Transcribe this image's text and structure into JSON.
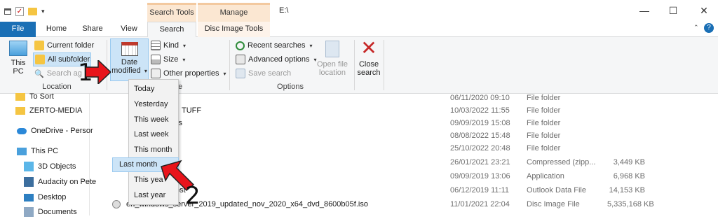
{
  "title": {
    "path": "E:\\"
  },
  "context_tabs": {
    "search_tools": "Search Tools",
    "manage": "Manage"
  },
  "tabs": [
    {
      "label": "File"
    },
    {
      "label": "Home"
    },
    {
      "label": "Share"
    },
    {
      "label": "View"
    },
    {
      "label": "Search"
    },
    {
      "label": "Disc Image Tools"
    }
  ],
  "ribbon": {
    "location": {
      "this_pc": "This PC",
      "current_folder": "Current folder",
      "all_subfolders": "All subfolders",
      "search_again": "Search again in",
      "label": "Location"
    },
    "refine": {
      "date_modified_line1": "Date",
      "date_modified_line2": "modified",
      "kind": "Kind",
      "size": "Size",
      "other_properties": "Other properties",
      "label": "e"
    },
    "options": {
      "recent_searches": "Recent searches",
      "advanced_options": "Advanced options",
      "save_search": "Save search",
      "open_file_location_1": "Open file",
      "open_file_location_2": "location",
      "label": "Options"
    },
    "close": {
      "line1": "Close",
      "line2": "search"
    }
  },
  "date_menu": [
    "Today",
    "Yesterday",
    "This week",
    "Last week",
    "This month",
    "Last month",
    "This year",
    "Last year"
  ],
  "date_menu_visible": [
    "Today",
    "Yesterday",
    "This week",
    "Last week",
    "This month",
    "Last month",
    "This yea",
    "Last year"
  ],
  "nav": [
    {
      "label": "To Sort",
      "icon": "folder-icon"
    },
    {
      "label": "ZERTO-MEDIA",
      "icon": "folder-icon"
    },
    {
      "label": "OneDrive - Persor",
      "icon": "cloud-icon"
    },
    {
      "label": "This PC",
      "icon": "computer-icon"
    },
    {
      "label": "3D Objects",
      "icon": "cube-icon"
    },
    {
      "label": "Audacity on Pete",
      "icon": "audio-icon"
    },
    {
      "label": "Desktop",
      "icon": "desktop-icon"
    },
    {
      "label": "Documents",
      "icon": "documents-icon"
    }
  ],
  "files": [
    {
      "name": "",
      "date": "06/11/2020 09:10",
      "type": "File folder",
      "size": ""
    },
    {
      "name": "TUFF",
      "date": "10/03/2022 11:55",
      "type": "File folder",
      "size": ""
    },
    {
      "name": "ls",
      "date": "09/09/2019 15:08",
      "type": "File folder",
      "size": ""
    },
    {
      "name": "",
      "date": "08/08/2022 15:48",
      "type": "File folder",
      "size": ""
    },
    {
      "name": "",
      "date": "25/10/2022 20:48",
      "type": "File folder",
      "size": ""
    },
    {
      "name": "",
      "date": "26/01/2021 23:21",
      "type": "Compressed (zipp...",
      "size": "3,449 KB"
    },
    {
      "name": "",
      "date": "09/09/2019 13:06",
      "type": "Application",
      "size": "6,968 KB"
    },
    {
      "name": "pst",
      "date": "06/12/2019 11:11",
      "type": "Outlook Data File",
      "size": "14,153 KB"
    },
    {
      "name": "en_windows_server_2019_updated_nov_2020_x64_dvd_8600b05f.iso",
      "date": "11/01/2021 22:04",
      "type": "Disc Image File",
      "size": "5,335,168 KB"
    }
  ],
  "annotations": {
    "step1": "1",
    "step2": "2"
  },
  "colors": {
    "file_tab": "#1a6fb5",
    "context_tab": "#fbe7d2",
    "highlight": "#cce4f7",
    "arrow": "#e8141b"
  }
}
